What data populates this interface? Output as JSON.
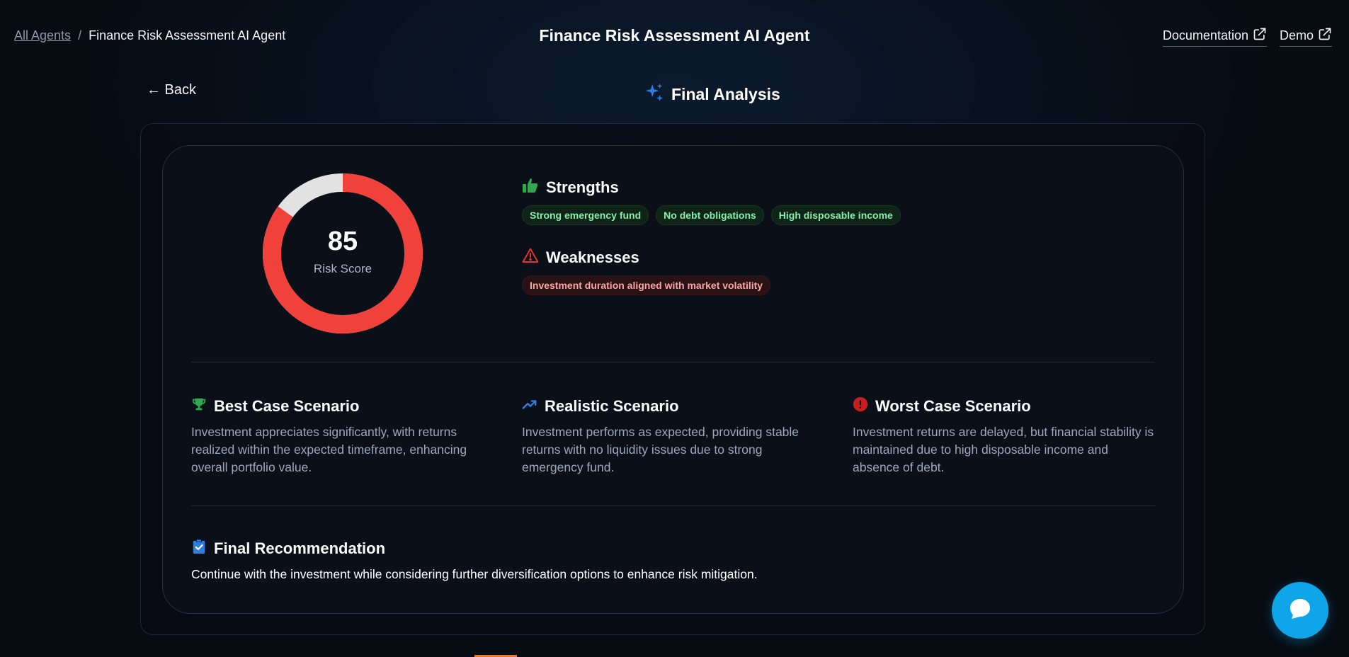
{
  "header": {
    "breadcrumb_root": "All Agents",
    "breadcrumb_sep": "/",
    "breadcrumb_current": "Finance Risk Assessment AI Agent",
    "title": "Finance Risk Assessment AI Agent",
    "documentation_label": "Documentation",
    "demo_label": "Demo"
  },
  "nav": {
    "back_label": "← Back",
    "section_title": "Final Analysis"
  },
  "risk": {
    "score": "85",
    "score_value": 85,
    "score_max": 100,
    "label": "Risk Score",
    "ring_color": "#f0423a",
    "track_color": "#e2e2e2"
  },
  "strengths": {
    "title": "Strengths",
    "items": [
      "Strong emergency fund",
      "No debt obligations",
      "High disposable income"
    ]
  },
  "weaknesses": {
    "title": "Weaknesses",
    "items": [
      "Investment duration aligned with market volatility"
    ]
  },
  "scenarios": {
    "best": {
      "title": "Best Case Scenario",
      "text": "Investment appreciates significantly, with returns realized within the expected timeframe, enhancing overall portfolio value."
    },
    "realistic": {
      "title": "Realistic Scenario",
      "text": "Investment performs as expected, providing stable returns with no liquidity issues due to strong emergency fund."
    },
    "worst": {
      "title": "Worst Case Scenario",
      "text": "Investment returns are delayed, but financial stability is maintained due to high disposable income and absence of debt."
    }
  },
  "recommendation": {
    "title": "Final Recommendation",
    "text": "Continue with the investment while considering further diversification options to enhance risk mitigation."
  },
  "icons": {
    "documentation": "external-link-icon",
    "demo": "external-link-icon",
    "section": "sparkles-icon",
    "strengths": "thumbs-up-icon",
    "weaknesses": "warning-triangle-icon",
    "best": "trophy-icon",
    "realistic": "trending-up-icon",
    "worst": "alert-circle-icon",
    "recommendation": "clipboard-check-icon",
    "chat": "chat-bubble-icon"
  },
  "colors": {
    "accent_blue": "#2f7fe0",
    "success_green": "#2fa84f",
    "danger_red": "#e0352b",
    "chat_button": "#0ea5e9"
  }
}
